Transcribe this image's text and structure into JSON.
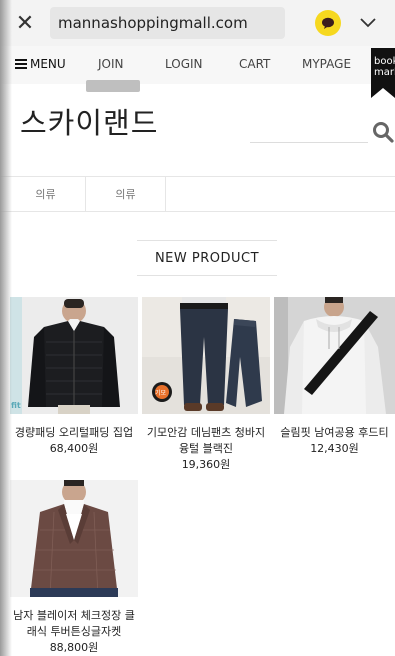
{
  "browser": {
    "url": "mannashoppingmall.com",
    "close_icon": "close-icon",
    "kakao_icon": "kakao-chat-icon",
    "chevron_icon": "chevron-down-icon"
  },
  "nav": {
    "menu_label": "MENU",
    "join": "JOIN",
    "login": "LOGIN",
    "cart": "CART",
    "mypage": "MYPAGE",
    "bookmark_line1": "book",
    "bookmark_line2": "mark"
  },
  "site": {
    "logo": "스카이랜드",
    "search_icon": "search-icon"
  },
  "categories": [
    "의류",
    "의류"
  ],
  "section_title": "NEW PRODUCT",
  "products": [
    {
      "name": "경량패딩 오리털패딩 집업",
      "price": "68,400원",
      "badge": "fit"
    },
    {
      "name": "기모안감 데님팬츠 청바지 융털 블랙진",
      "price": "19,360원",
      "badge": "기모"
    },
    {
      "name": "슬림핏 남여공용 후드티",
      "price": "12,430원"
    },
    {
      "name": "남자 블레이저 체크정장 클래식 투버튼싱글자켓",
      "price": "88,800원"
    }
  ],
  "colors": {
    "kakao_yellow": "#f6d81f",
    "nav_bg": "#f7f7f7",
    "address_bg": "#f3f3f3"
  }
}
